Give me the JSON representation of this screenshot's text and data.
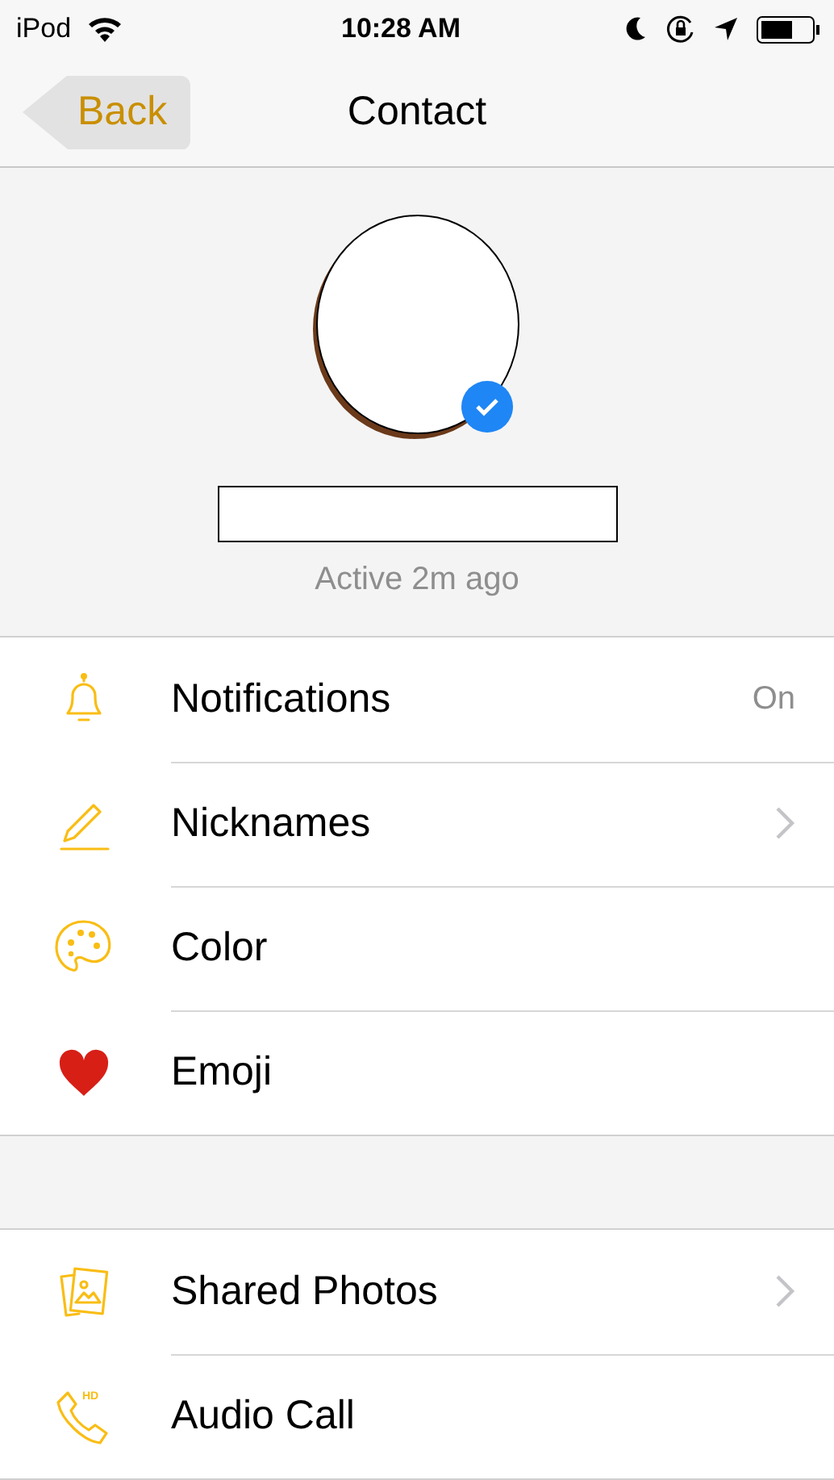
{
  "status_bar": {
    "carrier": "iPod",
    "time": "10:28 AM"
  },
  "nav": {
    "back": "Back",
    "title": "Contact"
  },
  "profile": {
    "verified": true,
    "status": "Active 2m ago"
  },
  "sections": [
    {
      "rows": [
        {
          "kind": "bell",
          "label": "Notifications",
          "value": "On",
          "chevron": false
        },
        {
          "kind": "pencil",
          "label": "Nicknames",
          "chevron": true
        },
        {
          "kind": "palette",
          "label": "Color",
          "chevron": false
        },
        {
          "kind": "heart",
          "label": "Emoji",
          "chevron": false
        }
      ]
    },
    {
      "rows": [
        {
          "kind": "photos",
          "label": "Shared Photos",
          "chevron": true
        },
        {
          "kind": "phone",
          "icon_badge": "HD",
          "label": "Audio Call",
          "chevron": false
        }
      ]
    }
  ]
}
